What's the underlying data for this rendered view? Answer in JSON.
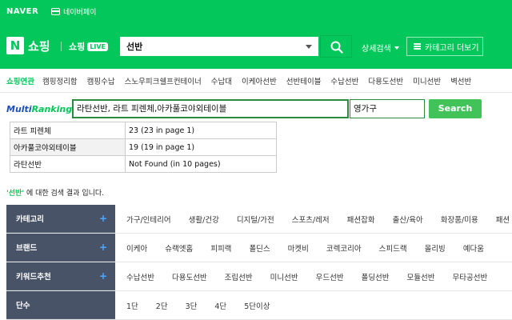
{
  "topbar": {
    "brand": "NAVER",
    "pay_label": "네이버페이"
  },
  "header": {
    "logo_letter": "N",
    "title": "쇼핑",
    "live_prefix": "쇼핑",
    "live_badge": "LIVE",
    "search_value": "선반",
    "advanced_search": "상세검색",
    "category_more": "카테고리 더보기"
  },
  "related": {
    "label": "쇼핑연관",
    "items": [
      "캠핑정리함",
      "캠핑수납",
      "스노우피크쉘프컨테이너",
      "수납대",
      "이케아선반",
      "선반테이블",
      "수납선반",
      "다용도선반",
      "미니선반",
      "벽선반"
    ]
  },
  "multiranking": {
    "logo_part1": "Multi",
    "logo_part2": "Ranking",
    "keywords_value": "라탄선반, 라트 피렌체,아카풀코야외테이블",
    "store_value": "영가구",
    "search_label": "Search",
    "results": [
      {
        "keyword": "라트 피렌체",
        "result": "23 (23 in page 1)"
      },
      {
        "keyword": "아카풀코야외테이블",
        "result": "19 (19 in page 1)"
      },
      {
        "keyword": "라탄선반",
        "result": "Not Found (in 10 pages)"
      }
    ]
  },
  "result_message": {
    "keyword": "'선반'",
    "suffix": " 에 대한 검색 결과 입니다."
  },
  "filters": [
    {
      "label": "카테고리",
      "plus": "+",
      "values": [
        "가구/인테리어",
        "생활/건강",
        "디지털/가전",
        "스포츠/레저",
        "패션잡화",
        "출산/육아",
        "화장품/미용",
        "패션"
      ]
    },
    {
      "label": "브랜드",
      "plus": "+",
      "values": [
        "이케아",
        "슈랙엣홈",
        "피피랙",
        "폴딘스",
        "마켓비",
        "코렉코리아",
        "스피드랙",
        "올리빙",
        "예다움"
      ]
    },
    {
      "label": "키워드추천",
      "plus": "+",
      "values": [
        "수납선반",
        "다용도선반",
        "조립선반",
        "미니선반",
        "우드선반",
        "폴딩선반",
        "모듈선반",
        "무타공선반"
      ]
    },
    {
      "label": "단수",
      "plus": "",
      "values": [
        "1단",
        "2단",
        "3단",
        "4단",
        "5단이상"
      ]
    }
  ]
}
